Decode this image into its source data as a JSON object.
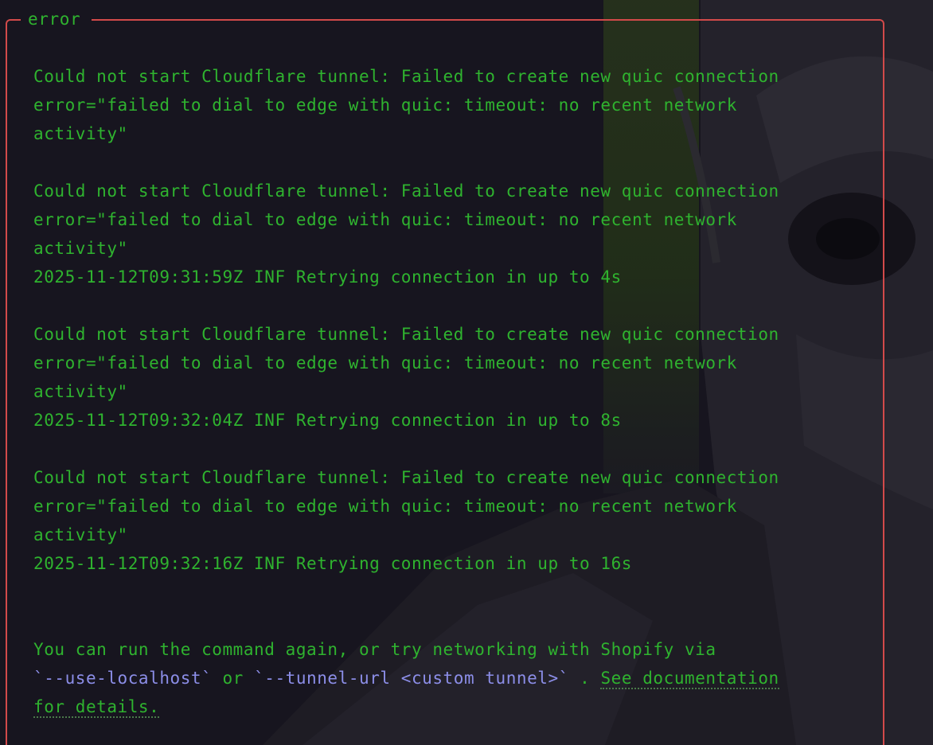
{
  "panel": {
    "title": "error"
  },
  "messages": [
    {
      "lines": [
        "Could not start Cloudflare tunnel: Failed to create new quic connection",
        "error=\"failed to dial to edge with quic: timeout: no recent network",
        "activity\""
      ],
      "retry": ""
    },
    {
      "lines": [
        "Could not start Cloudflare tunnel: Failed to create new quic connection",
        "error=\"failed to dial to edge with quic: timeout: no recent network",
        "activity\""
      ],
      "retry": "2025-11-12T09:31:59Z INF Retrying connection in up to 4s"
    },
    {
      "lines": [
        "Could not start Cloudflare tunnel: Failed to create new quic connection",
        "error=\"failed to dial to edge with quic: timeout: no recent network",
        "activity\""
      ],
      "retry": "2025-11-12T09:32:04Z INF Retrying connection in up to 8s"
    },
    {
      "lines": [
        "Could not start Cloudflare tunnel: Failed to create new quic connection",
        "error=\"failed to dial to edge with quic: timeout: no recent network",
        "activity\""
      ],
      "retry": "2025-11-12T09:32:16Z INF Retrying connection in up to 16s"
    }
  ],
  "hint": {
    "line1": "You can run the command again, or try networking with Shopify via",
    "flag_localhost": "`--use-localhost`",
    "or_text": " or ",
    "flag_tunnel_url": "`--tunnel-url <custom tunnel>`",
    "dot": " . ",
    "link_part1": "See documentation",
    "link_part2": "for details."
  },
  "colors": {
    "text": "#2fb32f",
    "border": "#d24a4a",
    "code": "#8c8ee8",
    "background": "#17151f"
  }
}
